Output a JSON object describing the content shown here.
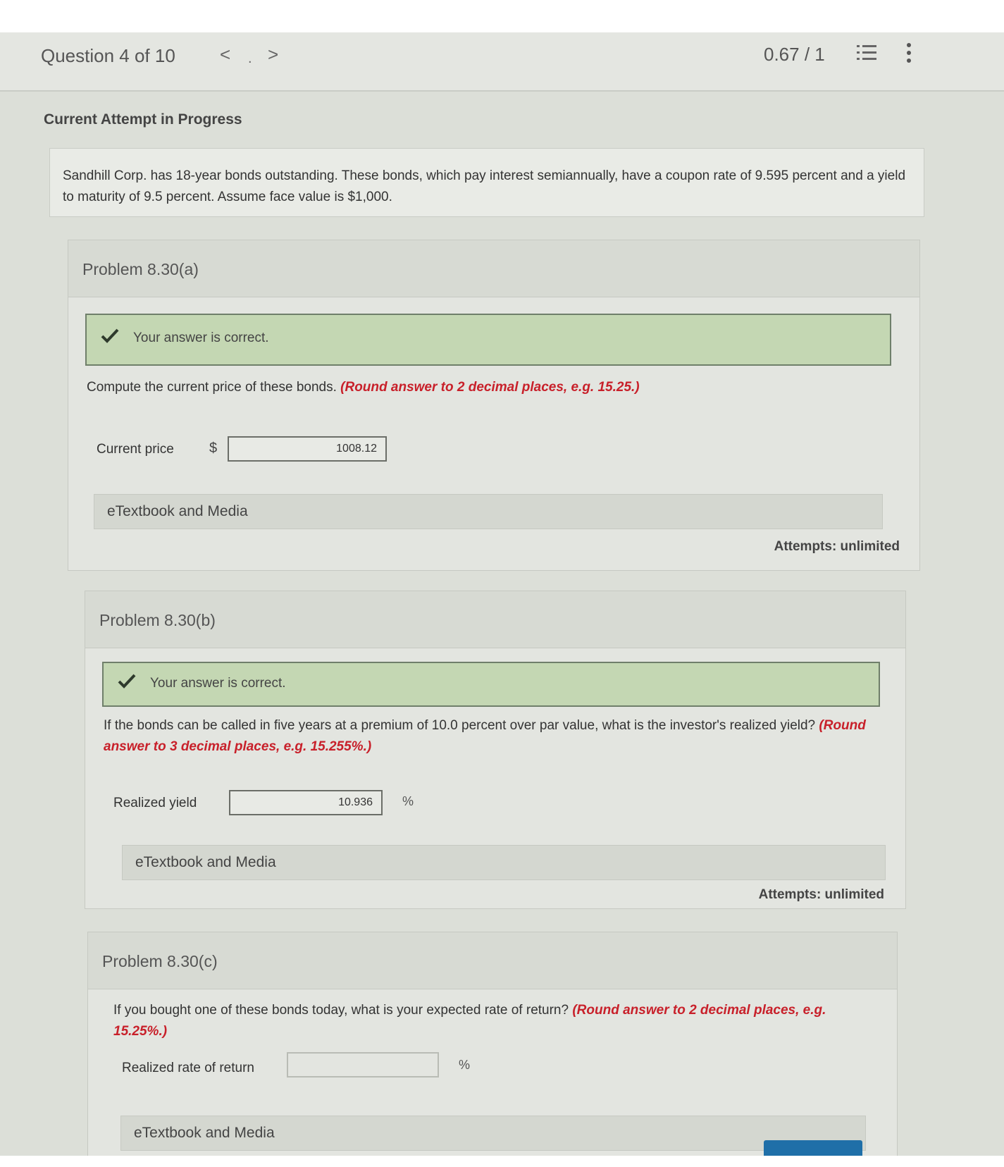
{
  "header": {
    "question_label": "Question 4 of 10",
    "prev_symbol": "<",
    "dot_symbol": ".",
    "next_symbol": ">",
    "score": "0.67 / 1"
  },
  "attempt_status": "Current Attempt in Progress",
  "prompt": "Sandhill Corp. has 18-year bonds outstanding. These bonds, which pay interest semiannually, have a coupon rate of 9.595 percent and a yield to maturity of 9.5 percent. Assume face value is $1,000.",
  "parts": [
    {
      "title": "Problem 8.30(a)",
      "feedback": "Your answer is correct.",
      "question": "Compute the current price of these bonds.",
      "hint": "(Round answer to 2 decimal places, e.g. 15.25.)",
      "field_label": "Current price",
      "prefix": "$",
      "value": "1008.12",
      "suffix": "",
      "media_label": "eTextbook and Media",
      "attempts": "Attempts: unlimited"
    },
    {
      "title": "Problem 8.30(b)",
      "feedback": "Your answer is correct.",
      "question": "If the bonds can be called in five years at a premium of 10.0 percent over par value, what is the investor's realized yield?",
      "hint": "(Round answer to 3 decimal places, e.g. 15.255%.)",
      "field_label": "Realized yield",
      "prefix": "",
      "value": "10.936",
      "suffix": "%",
      "media_label": "eTextbook and Media",
      "attempts": "Attempts: unlimited"
    },
    {
      "title": "Problem 8.30(c)",
      "question": "If you bought one of these bonds today, what is your expected rate of return?",
      "hint": "(Round answer to 2 decimal places, e.g. 15.25%.)",
      "field_label": "Realized rate of return",
      "value": "",
      "suffix": "%",
      "media_label": "eTextbook and Media"
    }
  ],
  "icons": {
    "list": "list-icon",
    "more": "more-vertical-icon",
    "check": "check-icon"
  },
  "colors": {
    "correct_bg": "#c4d7b3",
    "hint_red": "#c8202a",
    "submit_blue": "#1f6fa8"
  }
}
